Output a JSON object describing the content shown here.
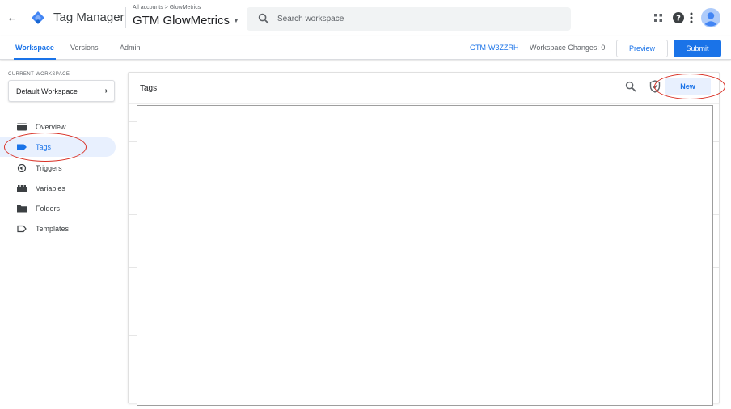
{
  "header": {
    "product_name": "Tag Manager",
    "breadcrumb": "All accounts > GlowMetrics",
    "container_name": "GTM GlowMetrics",
    "search_placeholder": "Search workspace"
  },
  "nav": {
    "tabs": [
      {
        "label": "Workspace",
        "active": true
      },
      {
        "label": "Versions",
        "active": false
      },
      {
        "label": "Admin",
        "active": false
      }
    ],
    "container_id": "GTM-W3ZZRH",
    "workspace_changes": "Workspace Changes: 0",
    "preview_label": "Preview",
    "submit_label": "Submit"
  },
  "sidebar": {
    "workspace_label": "CURRENT WORKSPACE",
    "workspace_name": "Default Workspace",
    "items": [
      {
        "label": "Overview",
        "icon": "overview-icon",
        "active": false
      },
      {
        "label": "Tags",
        "icon": "tag-icon",
        "active": true
      },
      {
        "label": "Triggers",
        "icon": "trigger-icon",
        "active": false
      },
      {
        "label": "Variables",
        "icon": "variables-icon",
        "active": false
      },
      {
        "label": "Folders",
        "icon": "folder-icon",
        "active": false
      },
      {
        "label": "Templates",
        "icon": "template-icon",
        "active": false
      }
    ]
  },
  "main": {
    "title": "Tags",
    "new_label": "New"
  },
  "colors": {
    "accent": "#1a73e8",
    "active_bg": "#e8f0fe",
    "annotation": "#d93025"
  }
}
